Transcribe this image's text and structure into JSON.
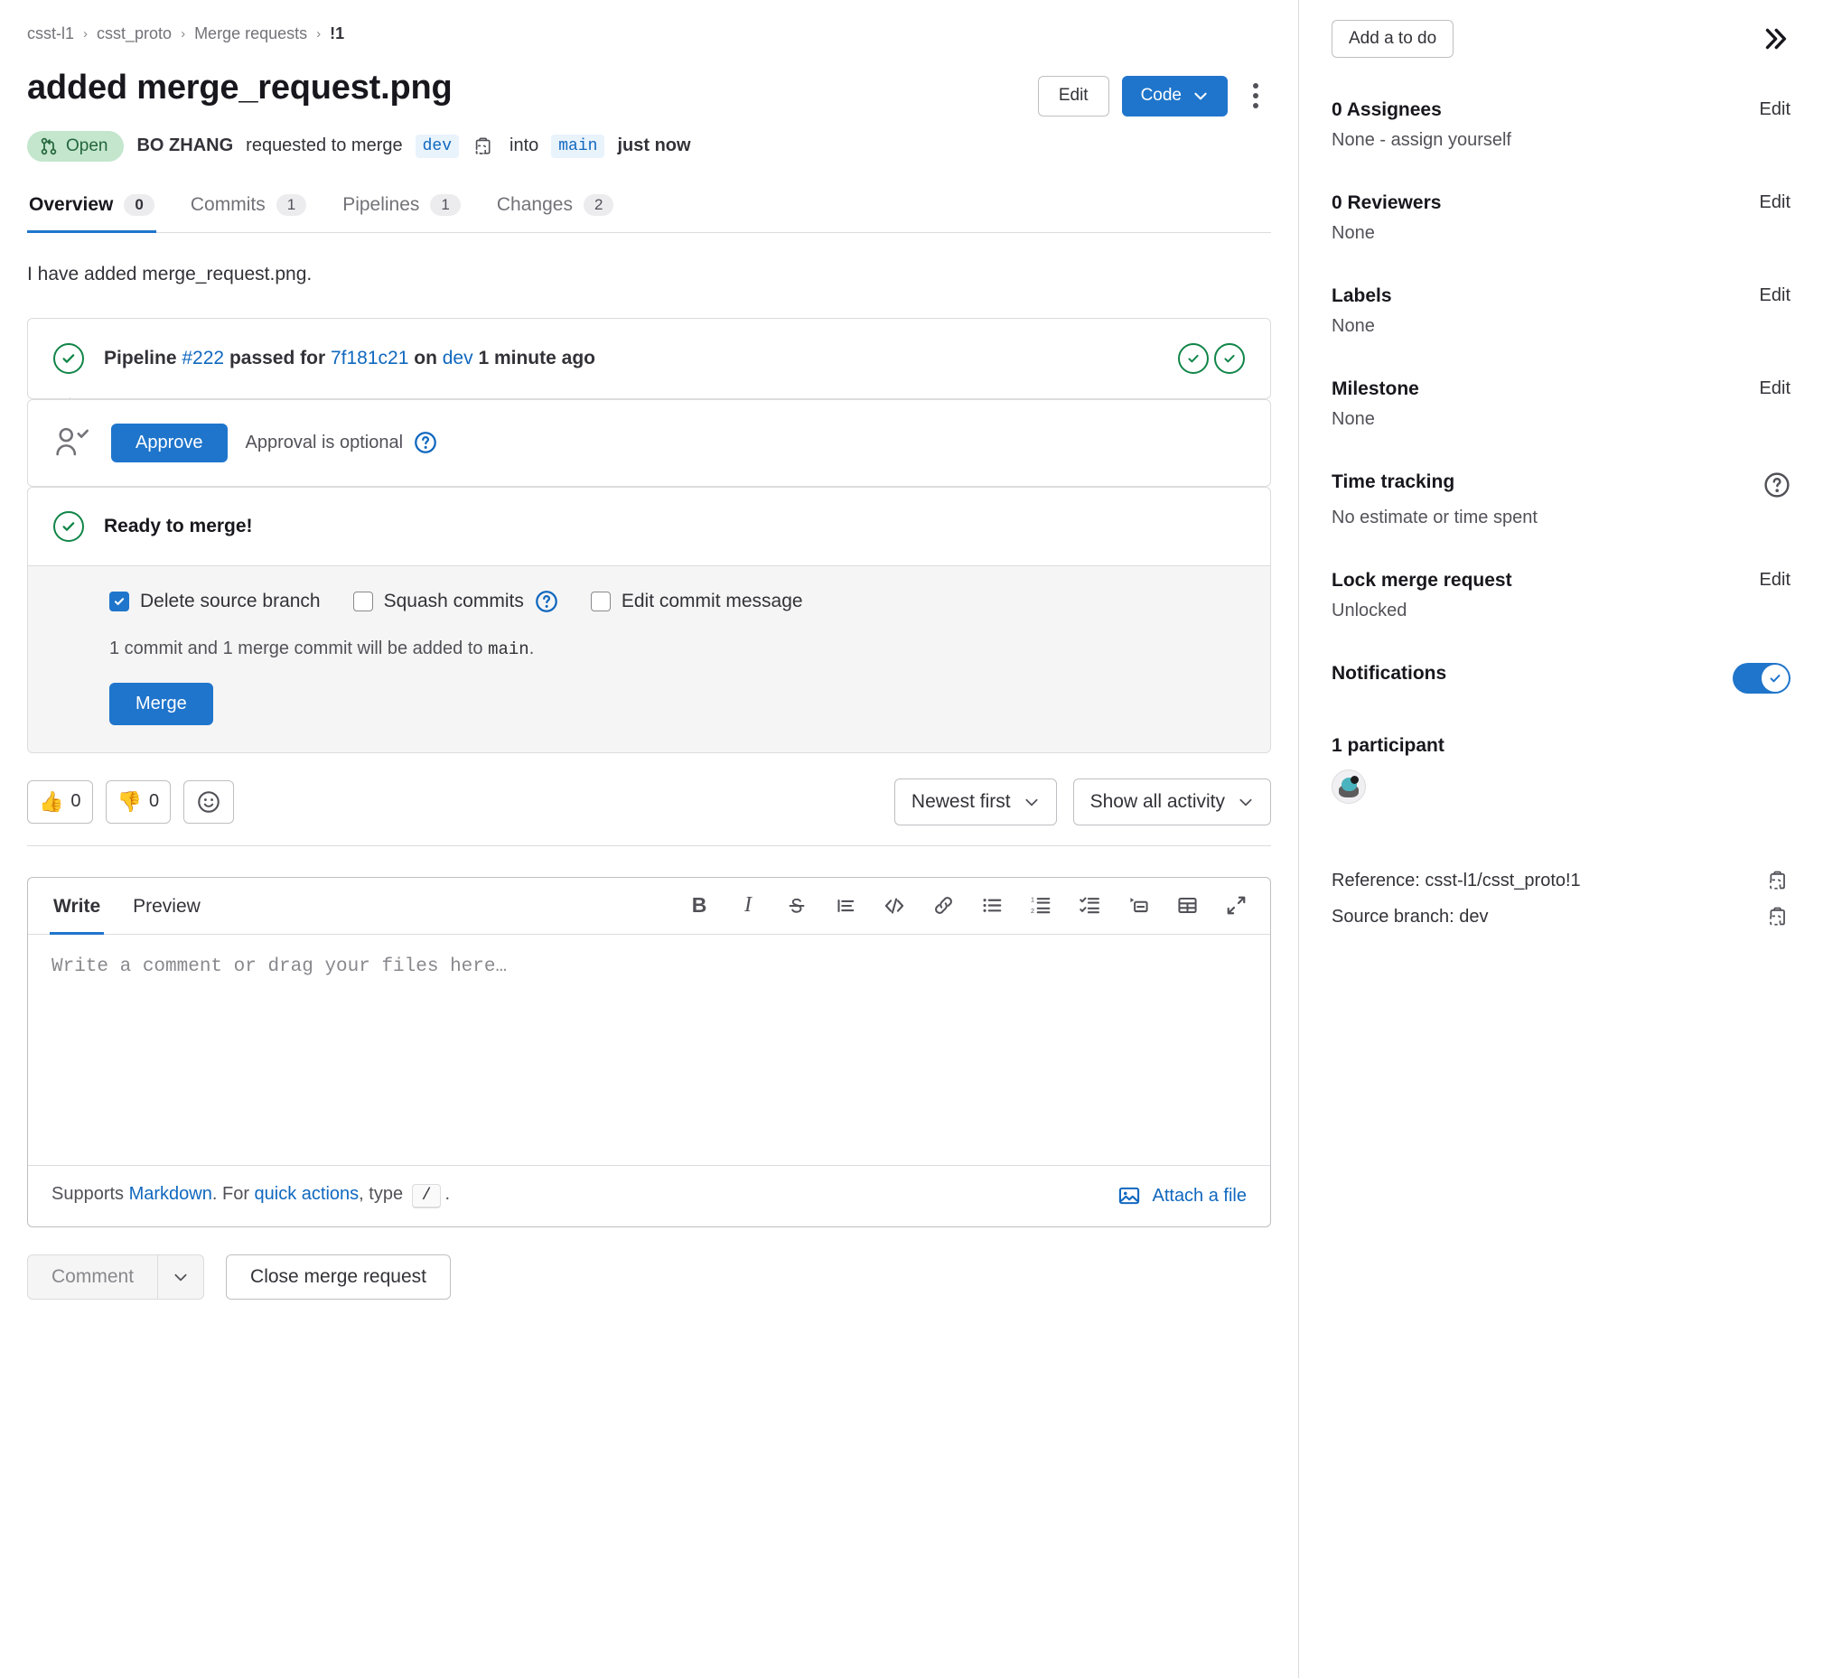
{
  "breadcrumb": {
    "items": [
      "csst-l1",
      "csst_proto",
      "Merge requests"
    ],
    "current": "!1",
    "separator": "›"
  },
  "header": {
    "title": "added merge_request.png",
    "edit_label": "Edit",
    "code_label": "Code",
    "more_actions": "more-actions"
  },
  "status": {
    "state_label": "Open",
    "author": "BO ZHANG",
    "action_text": "requested to merge",
    "source_branch": "dev",
    "into_text": "into",
    "target_branch": "main",
    "time_text": "just now"
  },
  "tabs": [
    {
      "label": "Overview",
      "count": "0",
      "active": true
    },
    {
      "label": "Commits",
      "count": "1",
      "active": false
    },
    {
      "label": "Pipelines",
      "count": "1",
      "active": false
    },
    {
      "label": "Changes",
      "count": "2",
      "active": false
    }
  ],
  "description": "I have added merge_request.png.",
  "pipeline": {
    "prefix": "Pipeline",
    "id": "#222",
    "middle": "passed for",
    "commit_sha": "7f181c21",
    "on_text": "on",
    "branch": "dev",
    "time": "1 minute ago"
  },
  "approval": {
    "button_label": "Approve",
    "note": "Approval is optional"
  },
  "merge": {
    "ready_title": "Ready to merge!",
    "options": [
      {
        "label": "Delete source branch",
        "checked": true,
        "has_help": false
      },
      {
        "label": "Squash commits",
        "checked": false,
        "has_help": true
      },
      {
        "label": "Edit commit message",
        "checked": false,
        "has_help": false
      }
    ],
    "note_prefix": "1 commit and 1 merge commit will be added to ",
    "note_branch": "main",
    "note_suffix": ".",
    "merge_button": "Merge"
  },
  "reactions": {
    "thumbs_up_count": "0",
    "thumbs_down_count": "0",
    "add_reaction": "add-reaction"
  },
  "activity_controls": {
    "sort": "Newest first",
    "filter": "Show all activity"
  },
  "editor": {
    "write_tab": "Write",
    "preview_tab": "Preview",
    "placeholder": "Write a comment or drag your files here…",
    "value": "",
    "toolbar": [
      "bold",
      "italic",
      "strikethrough",
      "quote",
      "code",
      "link",
      "bulleted-list",
      "numbered-list",
      "task-list",
      "collapsible-section",
      "table",
      "fullscreen"
    ],
    "footer": {
      "supports": "Supports ",
      "markdown_link": "Markdown",
      "mid": ". For ",
      "quick_actions_link": "quick actions",
      "type_text": ", type ",
      "slash_key": "/",
      "period": ".",
      "attach_label": "Attach a file"
    }
  },
  "bottom_actions": {
    "comment_label": "Comment",
    "close_label": "Close merge request"
  },
  "sidebar": {
    "todo_label": "Add a to do",
    "collapse": "collapse-sidebar",
    "blocks": [
      {
        "title": "0 Assignees",
        "value": "None - assign yourself",
        "action": "Edit"
      },
      {
        "title": "0 Reviewers",
        "value": "None",
        "action": "Edit"
      },
      {
        "title": "Labels",
        "value": "None",
        "action": "Edit"
      },
      {
        "title": "Milestone",
        "value": "None",
        "action": "Edit"
      },
      {
        "title": "Time tracking",
        "value": "No estimate or time spent",
        "action": "help"
      },
      {
        "title": "Lock merge request",
        "value": "Unlocked",
        "action": "Edit"
      },
      {
        "title": "Notifications",
        "value": "",
        "action": "toggle"
      }
    ],
    "participants_title": "1 participant",
    "reference_label": "Reference: csst-l1/csst_proto!1",
    "source_branch_label": "Source branch: dev"
  },
  "colors": {
    "accent": "#1f75cb",
    "success": "#108548",
    "open_bg": "#c3e6cd",
    "open_fg": "#24663b",
    "link": "#1068bf"
  }
}
